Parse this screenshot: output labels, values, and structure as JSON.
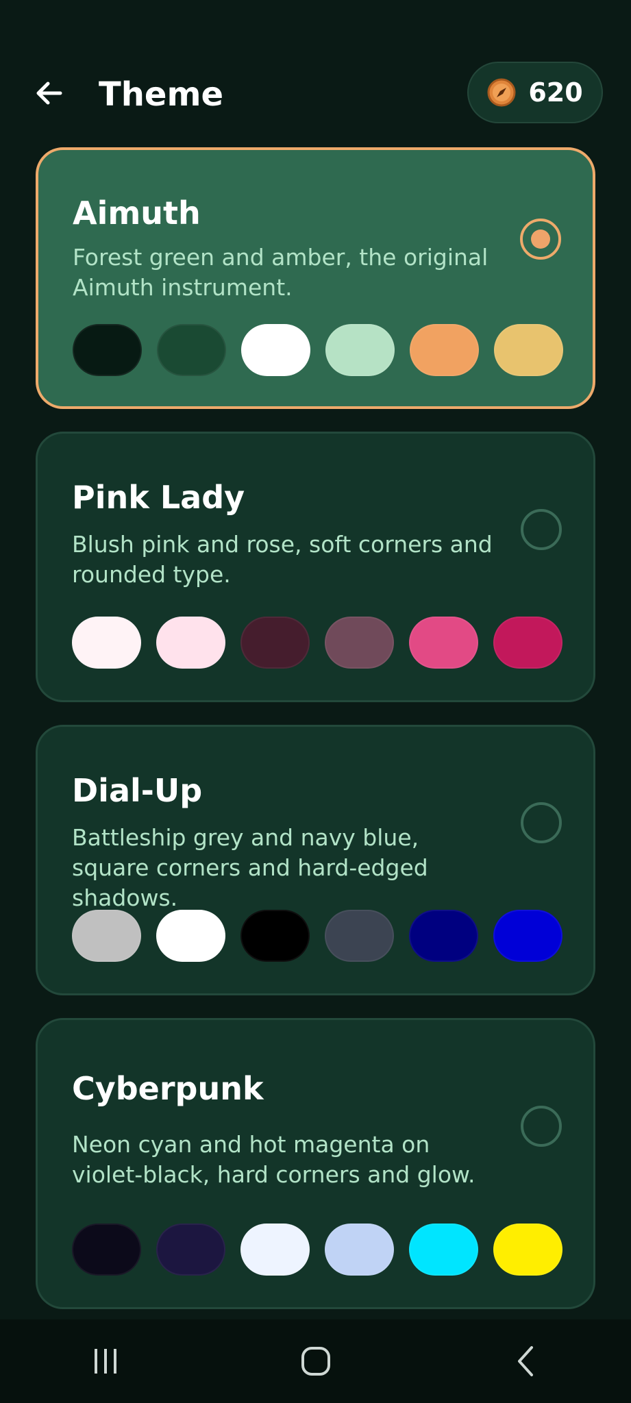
{
  "header": {
    "title": "Theme",
    "back_icon": "arrow-left-icon",
    "coins": {
      "icon": "compass-coin-icon",
      "count": "620"
    }
  },
  "themes": [
    {
      "name": "Aimuth",
      "description": "Forest green and amber, the original Aimuth instrument.",
      "selected": true,
      "swatches": [
        "#071a13",
        "#1a4a33",
        "#ffffff",
        "#b6e2c5",
        "#f1a261",
        "#e8c36e"
      ]
    },
    {
      "name": "Pink Lady",
      "description": "Blush pink and rose, soft corners and rounded type.",
      "selected": false,
      "swatches": [
        "#fff3f6",
        "#ffe2ec",
        "#451d2d",
        "#704a5a",
        "#e24a85",
        "#c2185b"
      ]
    },
    {
      "name": "Dial-Up",
      "description": "Battleship grey and navy blue, square corners and hard-edged shadows.",
      "selected": false,
      "swatches": [
        "#c0c0c0",
        "#ffffff",
        "#000000",
        "#3c4452",
        "#000080",
        "#0000d7"
      ]
    },
    {
      "name": "Cyberpunk",
      "description": "Neon cyan and hot magenta on violet-black, hard corners and glow.",
      "selected": false,
      "swatches": [
        "#0c0a1a",
        "#1c1640",
        "#eef4ff",
        "#c0d3f5",
        "#00e5ff",
        "#ffee00"
      ]
    }
  ],
  "navbar": {
    "recents_icon": "recents-icon",
    "home_icon": "home-icon",
    "back_icon": "back-chevron-icon"
  },
  "colors": {
    "background": "#0a1a15",
    "card": "#133529",
    "card_selected": "#2f6a50",
    "accent": "#eeaa6b",
    "description_text": "#b2e3c7"
  }
}
